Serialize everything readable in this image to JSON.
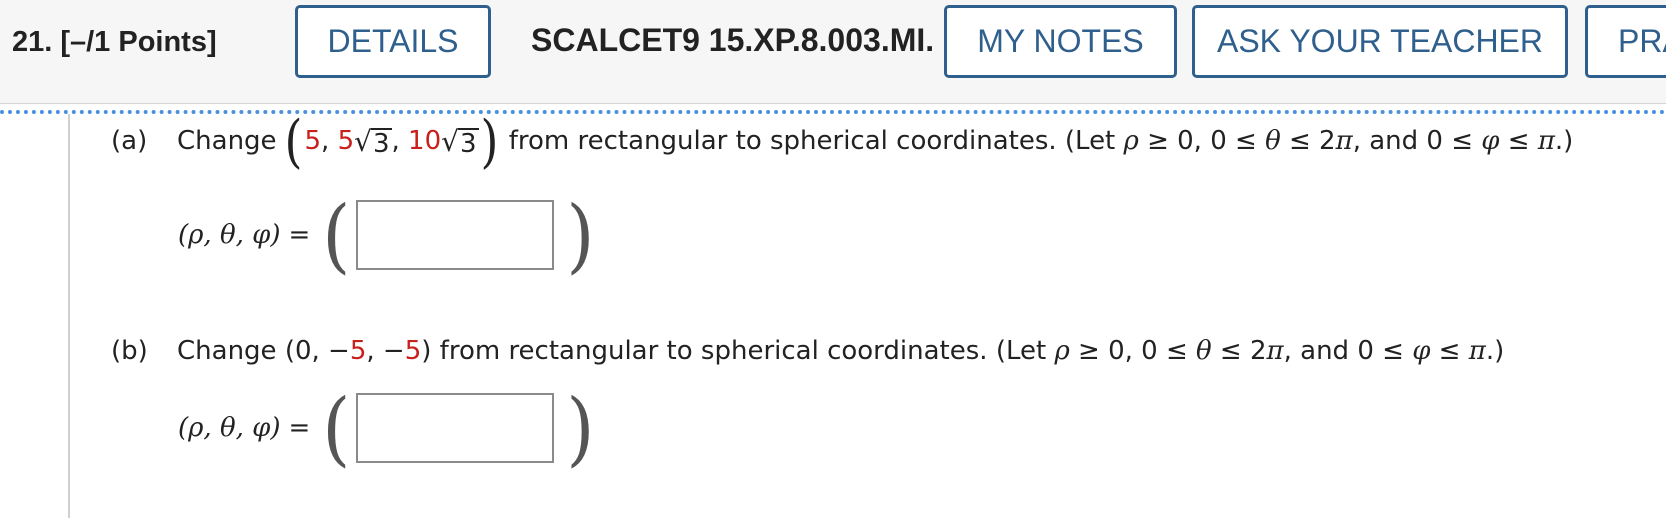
{
  "header": {
    "question_number": "21.",
    "points": "[–/1 Points]",
    "details_label": "DETAILS",
    "problem_code": "SCALCET9 15.XP.8.003.MI.",
    "my_notes_label": "MY NOTES",
    "ask_teacher_label": "ASK YOUR TEACHER",
    "practice_label": "PRA"
  },
  "part_a": {
    "label": "(a)",
    "change_word": "Change",
    "x_value": "5",
    "y_coef": "5",
    "z_coef": "10",
    "sqrt_arg": "3",
    "sep": ",",
    "rest_text": "from rectangular to spherical coordinates. (Let",
    "rho": "ρ",
    "cond1": "≥ 0, 0 ≤",
    "theta": "θ",
    "cond2": "≤ 2",
    "pi": "π",
    "cond3": ", and 0 ≤",
    "phi": "φ",
    "cond4": "≤",
    "end": ".)",
    "answer_lhs": "(ρ, θ, φ)",
    "equals": "=",
    "answer_value": ""
  },
  "part_b": {
    "label": "(b)",
    "change_word": "Change",
    "open": "(0,",
    "minus": "−",
    "y_value": "5",
    "comma": ",",
    "z_value": "5",
    "close": ")",
    "rest_text": "from rectangular to spherical coordinates. (Let",
    "rho": "ρ",
    "cond1": "≥ 0, 0 ≤",
    "theta": "θ",
    "cond2": "≤ 2",
    "pi": "π",
    "cond3": ", and 0 ≤",
    "phi": "φ",
    "cond4": "≤",
    "end": ".)",
    "answer_lhs": "(ρ, θ, φ)",
    "equals": "=",
    "answer_value": ""
  },
  "colors": {
    "accent": "#2f5f8c",
    "highlight": "#c8201c",
    "dotted_rule": "#4a90e2"
  }
}
